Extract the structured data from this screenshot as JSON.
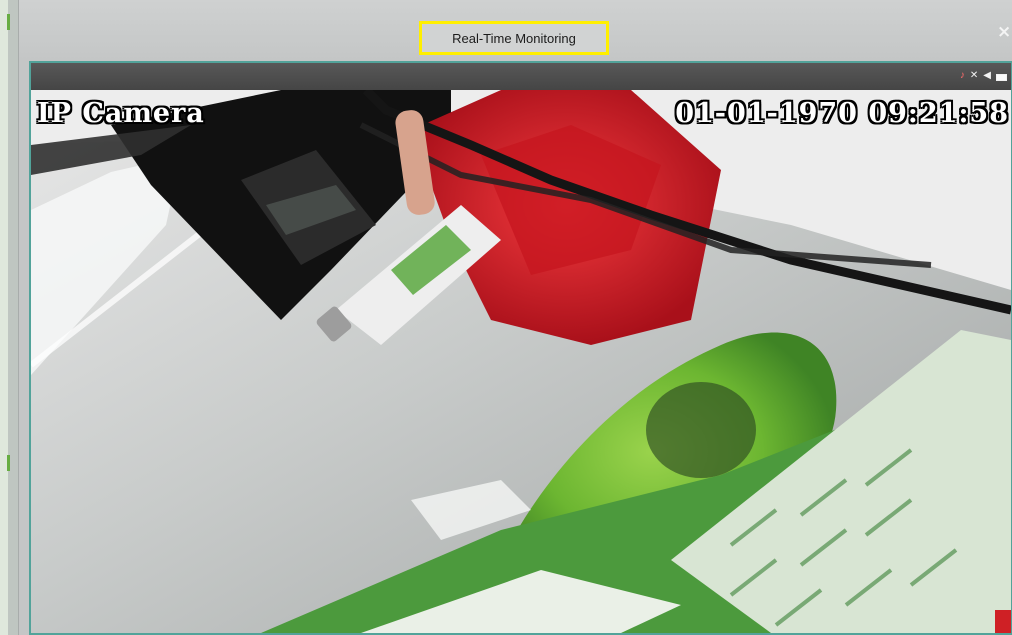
{
  "window": {
    "title": "Real-Time Monitoring",
    "close_label": "×"
  },
  "video": {
    "osd_camera_name": "IP Camera",
    "osd_date": "01-01-1970",
    "osd_time": "09:21:58"
  },
  "toolbar_icons": [
    {
      "icon": "audio-alert-icon",
      "glyph": "♪"
    },
    {
      "icon": "motion-detection-icon",
      "glyph": "✕"
    },
    {
      "icon": "speaker-icon",
      "glyph": "◀"
    },
    {
      "icon": "recording-icon",
      "glyph": ""
    }
  ],
  "colors": {
    "title_highlight": "#ffef00",
    "frame_border": "#52a39a"
  }
}
